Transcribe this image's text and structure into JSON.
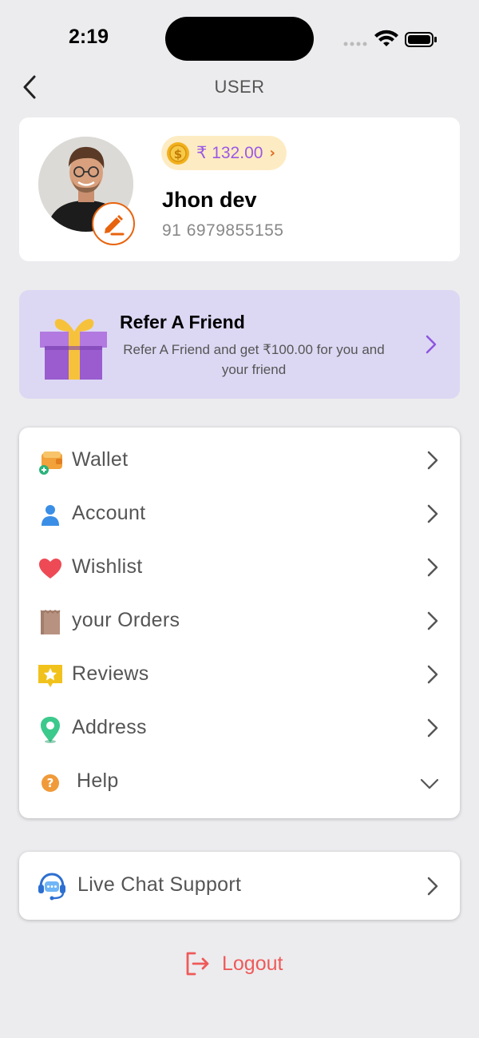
{
  "status_bar": {
    "time": "2:19"
  },
  "header": {
    "title": "USER"
  },
  "profile": {
    "coin_amount": "₹ 132.00",
    "name": "Jhon dev",
    "phone": "91 6979855155"
  },
  "refer": {
    "title": "Refer A Friend",
    "description": "Refer A Friend and get ₹100.00 for you and your friend"
  },
  "menu": {
    "items": [
      {
        "label": "Wallet",
        "icon": "wallet-icon"
      },
      {
        "label": "Account",
        "icon": "user-icon"
      },
      {
        "label": "Wishlist",
        "icon": "heart-icon"
      },
      {
        "label": "your Orders",
        "icon": "bag-icon"
      },
      {
        "label": "Reviews",
        "icon": "star-review-icon"
      },
      {
        "label": "Address",
        "icon": "location-pin-icon"
      },
      {
        "label": "Help",
        "icon": "question-icon"
      }
    ]
  },
  "support": {
    "label": "Live Chat Support"
  },
  "logout": {
    "label": "Logout"
  },
  "colors": {
    "background": "#ececee",
    "accent_purple": "#9b59e6",
    "refer_bg": "#dcd8f3",
    "logout_red": "#ee5a5a",
    "edit_orange": "#e8630d"
  }
}
